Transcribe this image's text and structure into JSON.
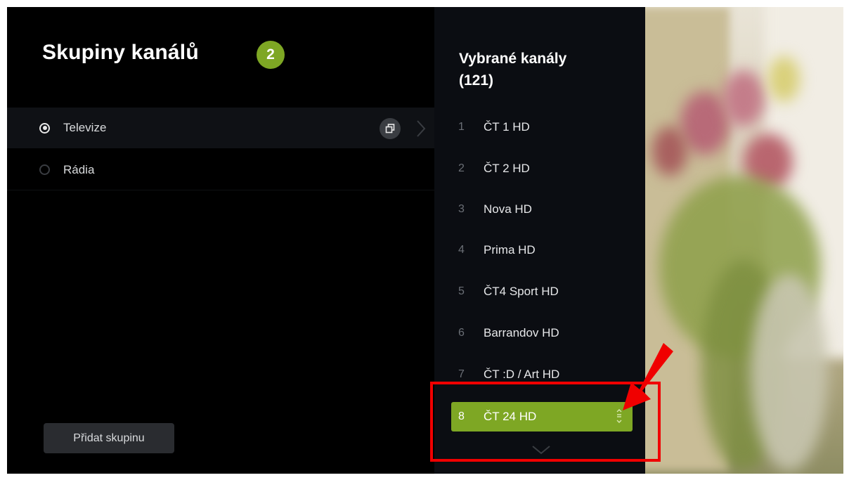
{
  "groups_panel": {
    "title": "Skupiny kanálů",
    "count_badge": "2",
    "items": [
      {
        "label": "Televize",
        "selected": true
      },
      {
        "label": "Rádia",
        "selected": false
      }
    ],
    "add_button_label": "Přidat skupinu",
    "icons": [
      "radio-selected-icon",
      "radio-unselected-icon",
      "copy-icon",
      "chevron-right-icon"
    ]
  },
  "channels_panel": {
    "title": "Vybrané kanály",
    "count": "(121)",
    "channels": [
      {
        "number": "1",
        "name": "ČT 1 HD"
      },
      {
        "number": "2",
        "name": "ČT 2 HD"
      },
      {
        "number": "3",
        "name": "Nova HD"
      },
      {
        "number": "4",
        "name": "Prima HD"
      },
      {
        "number": "5",
        "name": "ČT4 Sport HD"
      },
      {
        "number": "6",
        "name": "Barrandov HD"
      },
      {
        "number": "7",
        "name": "ČT :D / Art HD"
      },
      {
        "number": "8",
        "name": "ČT 24 HD"
      }
    ],
    "active_channel_index": 7,
    "icons": [
      "reorder-icon",
      "chevron-down-icon"
    ]
  },
  "colors": {
    "accent": "#7ea724",
    "background": "#000000",
    "channels_panel_bg": "#0b0d12",
    "selected_row_bg": "#0f1115",
    "annotation_red": "#f00000"
  }
}
